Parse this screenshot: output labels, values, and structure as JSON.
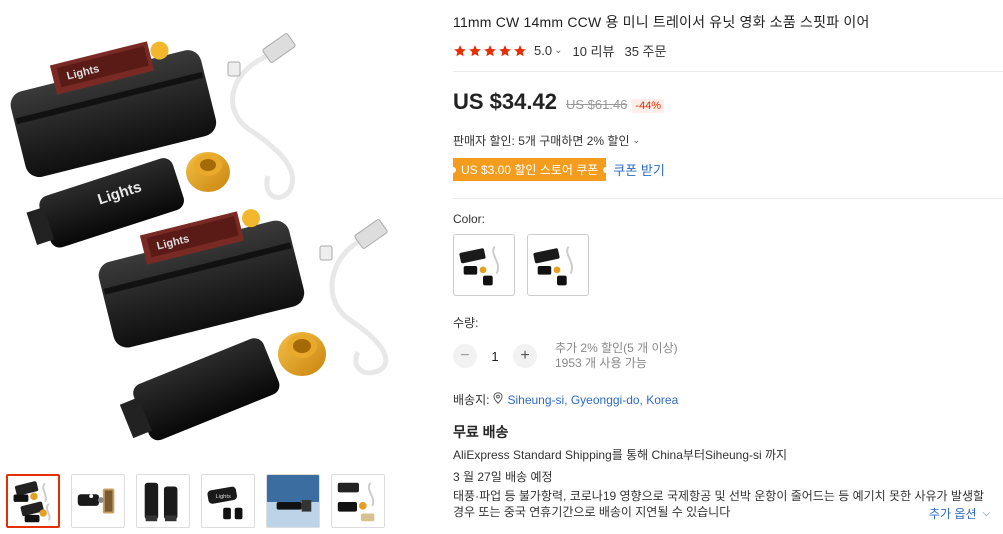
{
  "product": {
    "title": "11mm CW 14mm CCW 용 미니 트레이서 유닛 영화 소품 스핏파 이어",
    "rating": "5.0",
    "rating_caret": "⌄",
    "reviews": "10 리뷰",
    "orders": "35 주문",
    "star_count": 5,
    "star_color": "#e62e04"
  },
  "price": {
    "current": "US $34.42",
    "original": "US $61.46",
    "discount": "-44%"
  },
  "promotions": {
    "seller_discount": "판매자 할인: 5개 구매하면 2% 할인",
    "seller_caret": "⌄",
    "coupon": "US $3.00 할인 스토어 쿠폰",
    "coupon_link": "쿠폰 받기",
    "coupon_color": "#f39c1e"
  },
  "color": {
    "label": "Color:",
    "options": [
      "variant-1",
      "variant-2"
    ]
  },
  "quantity": {
    "label": "수량:",
    "value": "1",
    "minus": "−",
    "plus": "+",
    "bulk_note": "추가 2% 할인(5 개 이상)",
    "available": "1953 개 사용 가능"
  },
  "shipping": {
    "ship_to_label": "배송지:",
    "location": "Siheung-si, Gyeonggi-do, Korea",
    "free_label": "무료 배송",
    "method": "AliExpress Standard Shipping를 통해 China부터Siheung-si 까지",
    "estimated": "3 월 27일 배송 예정",
    "notice": "태풍·파업 등 불가항력, 코로나19 영향으로 국제항공 및 선박 운항이 줄어드는 등 예기치 못한 사유가 발생할 경우 또는 중국 연휴기간으로 배송이 지연될 수 있습니다",
    "more_options": "추가 옵션",
    "more_chevron": "⌵"
  },
  "gallery": {
    "product_label": "Lights",
    "active_thumb": 0,
    "thumb_count": 6
  }
}
